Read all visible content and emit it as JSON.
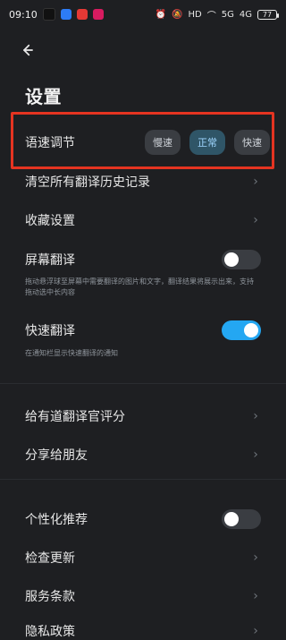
{
  "status_bar": {
    "time": "09:10",
    "battery": "77",
    "network_hd": "HD",
    "signal_left": "5G",
    "signal_right": "4G"
  },
  "header": {
    "title": "设置"
  },
  "speed": {
    "label": "语速调节",
    "options": [
      "慢速",
      "正常",
      "快速"
    ],
    "selected": "正常"
  },
  "items": {
    "clear_history": "清空所有翻译历史记录",
    "collection_settings": "收藏设置",
    "screen_translate": {
      "label": "屏幕翻译",
      "enabled": false,
      "helper": "拖动悬浮球至屏幕中需要翻译的图片和文字，翻译结果将展示出来，支持拖动选中长内容"
    },
    "quick_translate": {
      "label": "快速翻译",
      "enabled": true,
      "helper": "在通知栏显示快速翻译的通知"
    },
    "rate": "给有道翻译官评分",
    "share": "分享给朋友",
    "personalized": {
      "label": "个性化推荐",
      "enabled": false
    },
    "check_update": "检查更新",
    "terms": "服务条款",
    "privacy": "隐私政策"
  },
  "colors": {
    "background": "#1e1f22",
    "highlight_border": "#e53421",
    "toggle_on": "#24a7f2",
    "active_speed": "#2f5567"
  }
}
